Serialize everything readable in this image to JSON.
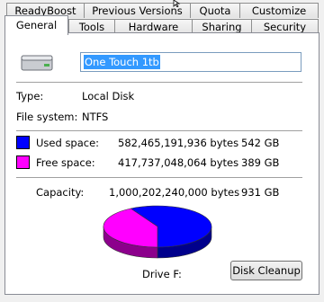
{
  "tabs_row1": [
    {
      "label": "ReadyBoost"
    },
    {
      "label": "Previous Versions"
    },
    {
      "label": "Quota"
    },
    {
      "label": "Customize"
    }
  ],
  "tabs_row2": [
    {
      "label": "General",
      "active": true
    },
    {
      "label": "Tools"
    },
    {
      "label": "Hardware"
    },
    {
      "label": "Sharing"
    },
    {
      "label": "Security"
    }
  ],
  "general": {
    "volume_name": "One Touch 1tb",
    "type_label": "Type:",
    "type_value": "Local Disk",
    "fs_label": "File system:",
    "fs_value": "NTFS",
    "used": {
      "label": "Used space:",
      "bytes": "582,465,191,936 bytes",
      "size": "542 GB",
      "color": "#0000ff"
    },
    "free": {
      "label": "Free space:",
      "bytes": "417,737,048,064 bytes",
      "size": "389 GB",
      "color": "#ff00ff"
    },
    "capacity": {
      "label": "Capacity:",
      "bytes": "1,000,202,240,000 bytes",
      "size": "931 GB"
    },
    "drive_label": "Drive F:",
    "disk_cleanup_button": "Disk Cleanup"
  },
  "chart_data": {
    "type": "pie",
    "slices": [
      {
        "label": "Used space",
        "value": 582465191936,
        "color": "#0000ff"
      },
      {
        "label": "Free space",
        "value": 417737048064,
        "color": "#ff00ff"
      }
    ]
  }
}
